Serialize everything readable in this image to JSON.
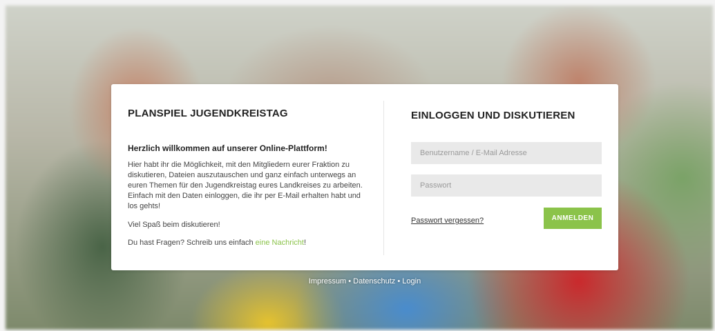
{
  "header": {
    "site_title": "PLANSPIEL JUGENDKREISTAG"
  },
  "intro": {
    "heading": "Herzlich willkommen auf unserer Online-Plattform!",
    "paragraph": "Hier habt ihr die Möglichkeit, mit den Mitgliedern eurer Fraktion zu diskutieren, Dateien auszutauschen und ganz einfach unterwegs an euren Themen für den Jugendkreistag eures Landkreises zu arbeiten. Einfach mit den Daten einloggen, die ihr per E-Mail erhalten habt und los gehts!",
    "fun_text": "Viel Spaß beim diskutieren!",
    "question_prefix": "Du hast Fragen? Schreib uns einfach ",
    "question_link": "eine Nachricht",
    "question_suffix": "!"
  },
  "login": {
    "title": "EINLOGGEN UND DISKUTIEREN",
    "username_placeholder": "Benutzername / E-Mail Adresse",
    "password_placeholder": "Passwort",
    "forgot_link": "Passwort vergessen?",
    "submit_label": "ANMELDEN"
  },
  "footer": {
    "impressum": "Impressum",
    "separator": " • ",
    "datenschutz": "Datenschutz",
    "login": "Login"
  },
  "colors": {
    "accent": "#8bc34a"
  }
}
